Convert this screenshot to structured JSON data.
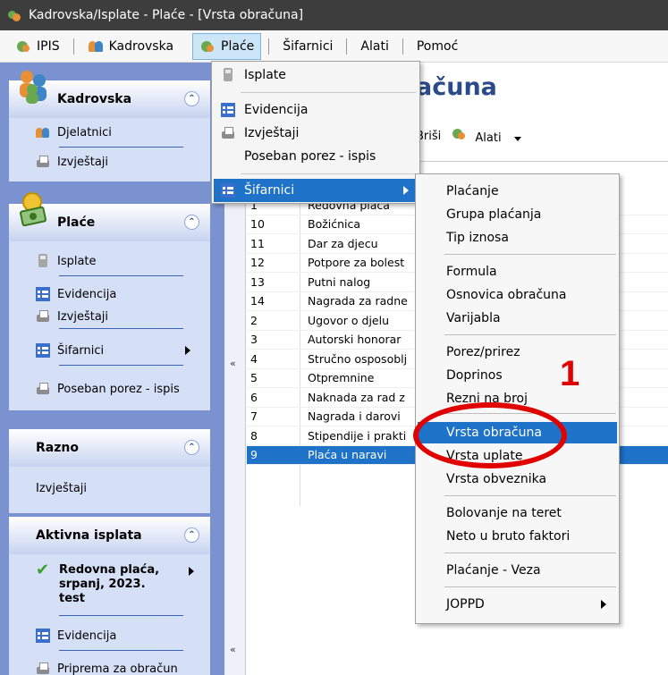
{
  "window": {
    "title": "Kadrovska/Isplate - Plaće - [Vrsta obračuna]"
  },
  "menubar": {
    "items": [
      {
        "label": "IPIS",
        "icon": "gear-icon"
      },
      {
        "label": "Kadrovska",
        "icon": "people-icon"
      },
      {
        "label": "Plaće",
        "icon": "gear-icon",
        "active": true
      },
      {
        "label": "Šifarnici"
      },
      {
        "label": "Alati"
      },
      {
        "label": "Pomoć"
      }
    ]
  },
  "dropdown": {
    "items": [
      {
        "label": "Isplate",
        "icon": "calculator-icon"
      },
      {
        "label": "Evidencija",
        "icon": "table-icon"
      },
      {
        "label": "Izvještaji",
        "icon": "printer-icon"
      },
      {
        "label": "Poseban porez - ispis"
      },
      {
        "label": "Šifarnici",
        "icon": "table-icon",
        "highlight": true
      }
    ]
  },
  "submenu": {
    "items": [
      "Plaćanje",
      "Grupa plaćanja",
      "Tip iznosa",
      "Formula",
      "Osnovica obračuna",
      "Varijabla",
      "Porez/prirez",
      "Doprinos",
      "Rezni na broj",
      "Vrsta obračuna",
      "Vrsta uplate",
      "Vrsta obveznika",
      "Bolovanje na teret",
      "Neto u bruto faktori",
      "Plaćanje - Veza",
      "JOPPD"
    ],
    "highlighted": "Vrsta obračuna"
  },
  "sidebar": {
    "kadrovska": {
      "title": "Kadrovska",
      "items": [
        "Djelatnici",
        "Izvještaji"
      ]
    },
    "place": {
      "title": "Plaće",
      "items": [
        "Isplate",
        "Evidencija",
        "Izvještaji",
        "Šifarnici",
        "Poseban porez - ispis"
      ]
    },
    "razno": {
      "title": "Razno",
      "items": [
        "Izvještaji"
      ]
    },
    "aktivna": {
      "title": "Aktivna isplata",
      "current": "Redovna plaća, srpanj, 2023. test",
      "items": [
        "Evidencija",
        "Priprema za obračun"
      ]
    }
  },
  "main": {
    "title_fragment": "ačuna",
    "toolbar": {
      "delete_label": "Briši",
      "tools_label": "Alati"
    },
    "rows": [
      {
        "code": "1",
        "name": "Redovna plaća"
      },
      {
        "code": "10",
        "name": "Božićnica"
      },
      {
        "code": "11",
        "name": "Dar za djecu"
      },
      {
        "code": "12",
        "name": "Potpore za bolest"
      },
      {
        "code": "13",
        "name": "Putni nalog"
      },
      {
        "code": "14",
        "name": "Nagrada za radne"
      },
      {
        "code": "2",
        "name": "Ugovor o djelu"
      },
      {
        "code": "3",
        "name": "Autorski honorar"
      },
      {
        "code": "4",
        "name": "Stručno osposoblj"
      },
      {
        "code": "5",
        "name": "Otpremnine"
      },
      {
        "code": "6",
        "name": "Naknada za rad z"
      },
      {
        "code": "7",
        "name": "Nagrada i darovi"
      },
      {
        "code": "8",
        "name": "Stipendije i prakti"
      },
      {
        "code": "9",
        "name": "Plaća u naravi"
      }
    ],
    "selected_row": "9"
  },
  "annotation": {
    "number": "1",
    "color": "#e00000"
  },
  "colors": {
    "highlight": "#1e72c8",
    "sidebar": "#7a93d0"
  }
}
